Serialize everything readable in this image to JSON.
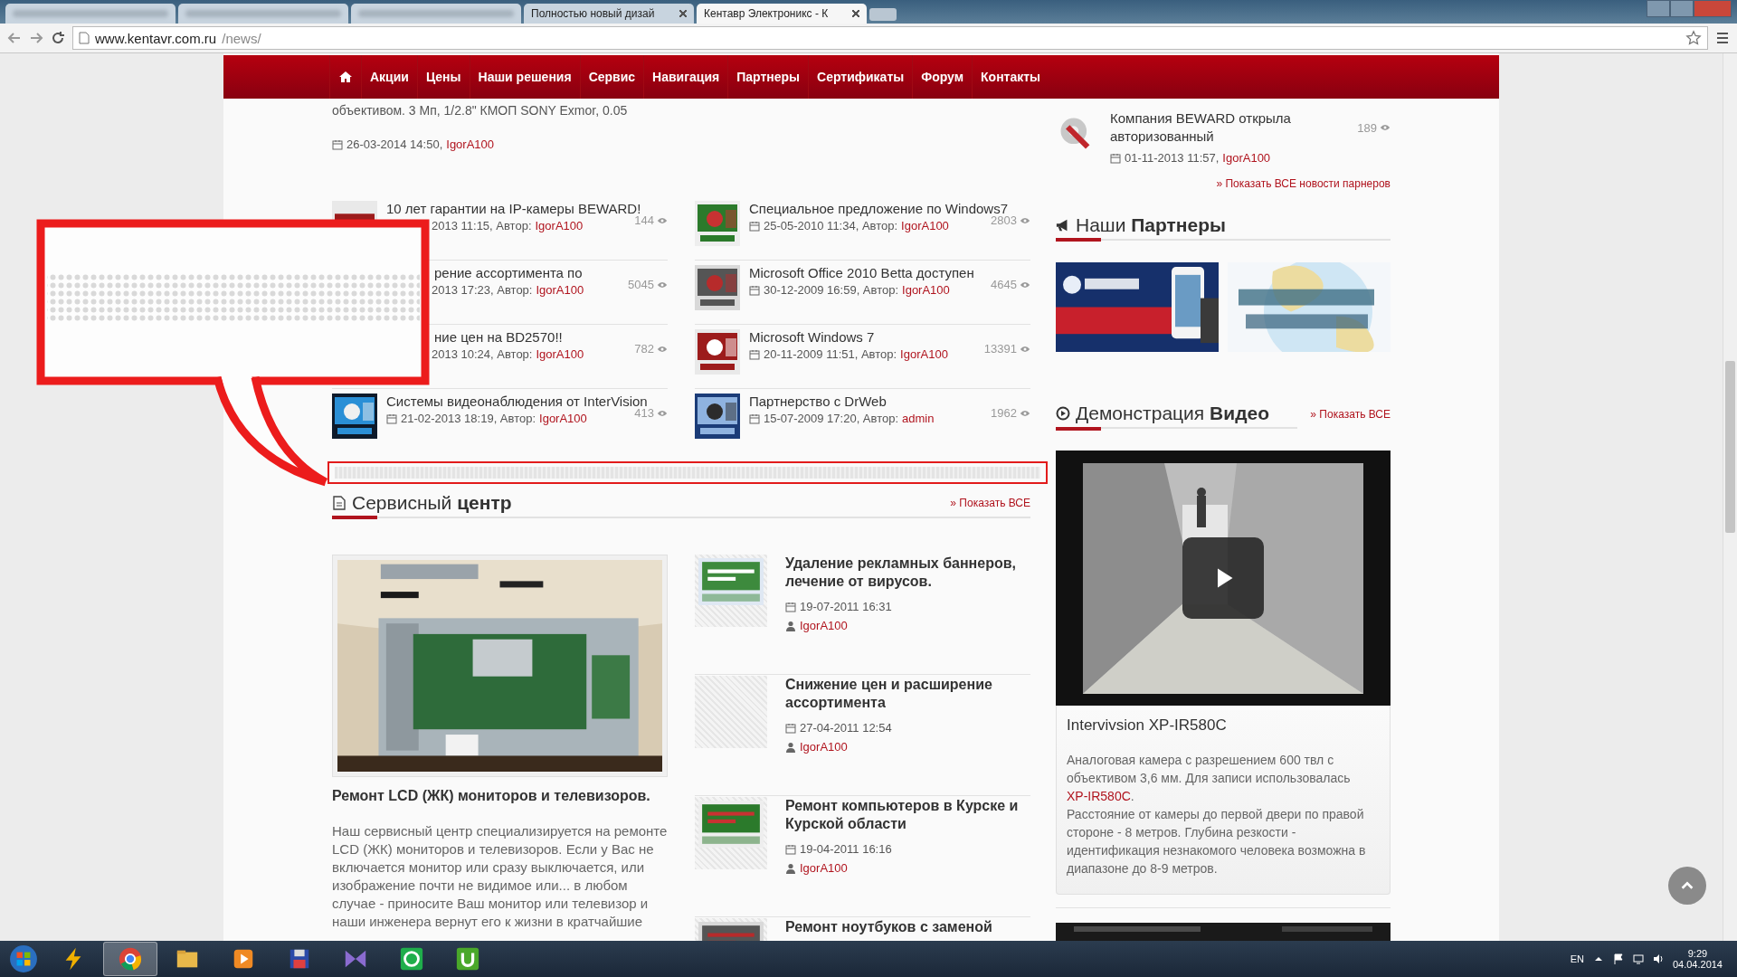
{
  "browser": {
    "tabs": [
      {
        "blurred": true,
        "selected": false
      },
      {
        "blurred": true,
        "selected": false
      },
      {
        "blurred": true,
        "selected": false
      },
      {
        "blurred": false,
        "title": "Полностью новый дизай",
        "selected": false
      },
      {
        "blurred": false,
        "title": "Кентавр Электроникс - К",
        "selected": true
      }
    ],
    "address": {
      "host": "www.kentavr.com.ru",
      "path": "/news/"
    }
  },
  "nav": [
    {
      "kind": "home"
    },
    {
      "kind": "link",
      "label": "Акции"
    },
    {
      "kind": "link",
      "label": "Цены"
    },
    {
      "kind": "link",
      "label": "Наши решения"
    },
    {
      "kind": "link",
      "label": "Сервис"
    },
    {
      "kind": "link",
      "label": "Навигация"
    },
    {
      "kind": "link",
      "label": "Партнеры"
    },
    {
      "kind": "link",
      "label": "Сертификаты"
    },
    {
      "kind": "link",
      "label": "Форум"
    },
    {
      "kind": "link",
      "label": "Контакты"
    }
  ],
  "intro": {
    "text": "объективом. 3 Мп, 1/2.8\" КМОП SONY Exmor, 0.05",
    "date": "26-03-2014 14:50,",
    "author": "IgorA100"
  },
  "news_columns": [
    [
      {
        "thumb": true,
        "covered": true,
        "title": "10 лет гарантии на IP-камеры BEWARD!",
        "date": "2013 11:15, Автор:",
        "author": "IgorA100",
        "views": "144"
      },
      {
        "thumb": false,
        "covered": true,
        "title": "рение ассортимента по",
        "date": "2013 17:23, Автор:",
        "author": "IgorA100",
        "views": "5045"
      },
      {
        "thumb": false,
        "covered": true,
        "title": "ние цен на BD2570!!",
        "date": "2013 10:24, Автор:",
        "author": "IgorA100",
        "views": "782"
      },
      {
        "thumb": true,
        "covered": false,
        "title": "Системы видеонаблюдения от InterVision",
        "date": "21-02-2013 18:19, Автор:",
        "author": "IgorA100",
        "views": "413"
      }
    ],
    [
      {
        "thumb": true,
        "covered": false,
        "title": "Специальное предложение по Windows7",
        "date": "25-05-2010 11:34, Автор:",
        "author": "IgorA100",
        "views": "2803"
      },
      {
        "thumb": true,
        "covered": false,
        "title": "Microsoft Office 2010 Betta доступен",
        "date": "30-12-2009 16:59, Автор:",
        "author": "IgorA100",
        "views": "4645"
      },
      {
        "thumb": true,
        "covered": false,
        "title": "Microsoft Windows 7",
        "date": "20-11-2009 11:51, Автор:",
        "author": "IgorA100",
        "views": "13391"
      },
      {
        "thumb": true,
        "covered": false,
        "title": "Партнерство с DrWeb",
        "date": "15-07-2009 17:20, Автор:",
        "author": "admin",
        "views": "1962"
      }
    ]
  ],
  "service": {
    "title": "Сервисный **центр**",
    "show_all": "» Показать ВСЕ",
    "feature": {
      "title": "Ремонт LCD (ЖК) мониторов и телевизоров.",
      "text": "Наш сервисный центр специализируется на ремонте LCD (ЖК) мониторов и телевизоров. Если у Вас не включается монитор или сразу выключается, или изображение почти не видимое или... в любом случае - приносите Ваш монитор или телевизор и наши инженера вернут его к жизни в кратчайшие"
    },
    "items": [
      {
        "thumb": true,
        "title": "Удаление рекламных баннеров, лечение от вирусов.",
        "date": "19-07-2011 16:31",
        "author": "IgorA100"
      },
      {
        "thumb": false,
        "title": "Снижение цен и расширение ассортимента",
        "date": "27-04-2011 12:54",
        "author": "IgorA100"
      },
      {
        "thumb": true,
        "title": "Ремонт компьютеров в Курске и Курской области",
        "date": "19-04-2011 16:16",
        "author": "IgorA100"
      },
      {
        "thumb": true,
        "title": "Ремонт ноутбуков с заменой"
      }
    ]
  },
  "partner_news": {
    "title": "Компания BEWARD открыла авторизованный",
    "views": "189",
    "date": "01-11-2013 11:57,",
    "author": "IgorA100",
    "show_all": "» Показать ВСЕ новости парнеров"
  },
  "partners": {
    "title": "Наши **Партнеры**"
  },
  "video": {
    "title": "Демонстрация **Видео**",
    "show_all": "» Показать ВСЕ",
    "name": "Intervivsion XP-IR580C",
    "desc_before": "Аналоговая камера с разрешением 600 твл с объективом 3,6 мм. Для записи использовалась",
    "link": "XP-IR580C",
    "desc_after": ".",
    "desc_more": "Расстояние от камеры до первой двери по правой стороне - 8 метров. Глубина резкости - идентификация незнакомого человека возможна в диапазоне до 8-9 метров."
  },
  "taskbar": {
    "apps": [
      {
        "kind": "bolt",
        "selected": false
      },
      {
        "kind": "browser",
        "selected": true
      },
      {
        "kind": "folder",
        "selected": false
      },
      {
        "kind": "media",
        "selected": false
      },
      {
        "kind": "floppy",
        "selected": false
      },
      {
        "kind": "bowtie",
        "selected": false
      },
      {
        "kind": "mail",
        "selected": false
      },
      {
        "kind": "torrent",
        "selected": false
      }
    ],
    "lang": "EN",
    "time": "9:29",
    "date": "04.04.2014"
  }
}
